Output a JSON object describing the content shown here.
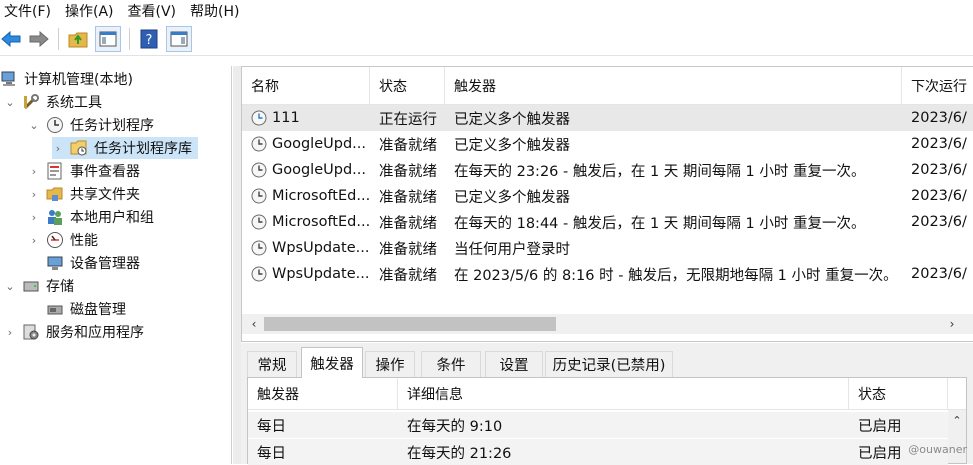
{
  "menu": [
    "文件(F)",
    "操作(A)",
    "查看(V)",
    "帮助(H)"
  ],
  "tree": {
    "root": "计算机管理(本地)",
    "system_tools": "系统工具",
    "task_scheduler": "任务计划程序",
    "task_library": "任务计划程序库",
    "event_viewer": "事件查看器",
    "shared_folders": "共享文件夹",
    "local_users": "本地用户和组",
    "performance": "性能",
    "device_manager": "设备管理器",
    "storage": "存储",
    "disk_management": "磁盘管理",
    "services_apps": "服务和应用程序"
  },
  "tasklist": {
    "columns": [
      "名称",
      "状态",
      "触发器",
      "下次运行"
    ],
    "rows": [
      {
        "name": "111",
        "status": "正在运行",
        "trigger": "已定义多个触发器",
        "next": "2023/6/"
      },
      {
        "name": "GoogleUpd...",
        "status": "准备就绪",
        "trigger": "已定义多个触发器",
        "next": "2023/6/"
      },
      {
        "name": "GoogleUpd...",
        "status": "准备就绪",
        "trigger": "在每天的 23:26 - 触发后，在 1 天 期间每隔 1 小时 重复一次。",
        "next": "2023/6/"
      },
      {
        "name": "MicrosoftEd...",
        "status": "准备就绪",
        "trigger": "已定义多个触发器",
        "next": "2023/6/"
      },
      {
        "name": "MicrosoftEd...",
        "status": "准备就绪",
        "trigger": "在每天的 18:44 - 触发后，在 1 天 期间每隔 1 小时 重复一次。",
        "next": "2023/6/"
      },
      {
        "name": "WpsUpdate...",
        "status": "准备就绪",
        "trigger": "当任何用户登录时",
        "next": ""
      },
      {
        "name": "WpsUpdate...",
        "status": "准备就绪",
        "trigger": "在 2023/5/6 的 8:16 时 - 触发后，无限期地每隔 1 小时 重复一次。",
        "next": "2023/6/"
      }
    ]
  },
  "tabs": [
    "常规",
    "触发器",
    "操作",
    "条件",
    "设置",
    "历史记录(已禁用)"
  ],
  "triggers": {
    "columns": [
      "触发器",
      "详细信息",
      "状态"
    ],
    "rows": [
      {
        "trigger": "每日",
        "detail": "在每天的 9:10",
        "status": "已启用"
      },
      {
        "trigger": "每日",
        "detail": "在每天的 21:26",
        "status": "已启用"
      }
    ]
  },
  "watermark": "@ouwaner",
  "colors": {
    "selection": "#cce4f7",
    "row_highlight": "#e8e8e8",
    "accent_blue": "#2b79d0"
  }
}
